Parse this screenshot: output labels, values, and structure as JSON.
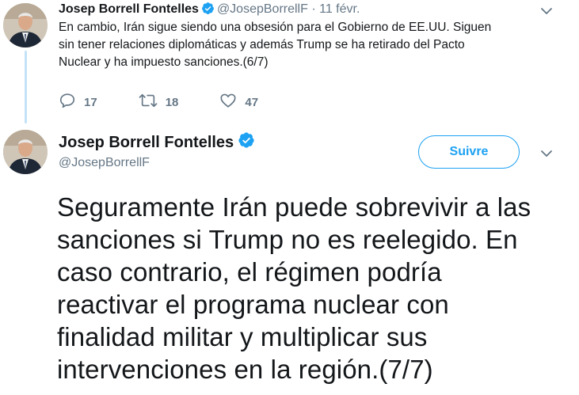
{
  "tweet1": {
    "name": "Josep Borrell Fontelles",
    "handle": "@JosepBorrellF",
    "separator": " · ",
    "date": "11 févr.",
    "lines": [
      "En cambio, Irán sigue siendo una obsesión para el Gobierno de EE.UU.  Siguen",
      "sin tener relaciones diplomáticas y además Trump se ha retirado del Pacto",
      "Nuclear y ha impuesto sanciones.(6/7)"
    ],
    "replies": "17",
    "retweets": "18",
    "likes": "47"
  },
  "tweet2": {
    "name": "Josep Borrell Fontelles",
    "handle": "@JosepBorrellF",
    "follow_label": "Suivre",
    "lines": [
      "Seguramente Irán puede sobrevivir a las",
      "sanciones si Trump no es reelegido. En",
      "caso contrario, el régimen podría",
      "reactivar el programa nuclear con",
      "finalidad militar y multiplicar sus",
      "intervenciones en la región.(7/7)"
    ]
  },
  "colors": {
    "accent": "#1da1f2",
    "muted": "#657786",
    "text": "#14171a",
    "thread_line": "#c4e2f7"
  },
  "icons": [
    "verified-badge-icon",
    "chevron-down-icon",
    "reply-icon",
    "retweet-icon",
    "like-icon"
  ]
}
